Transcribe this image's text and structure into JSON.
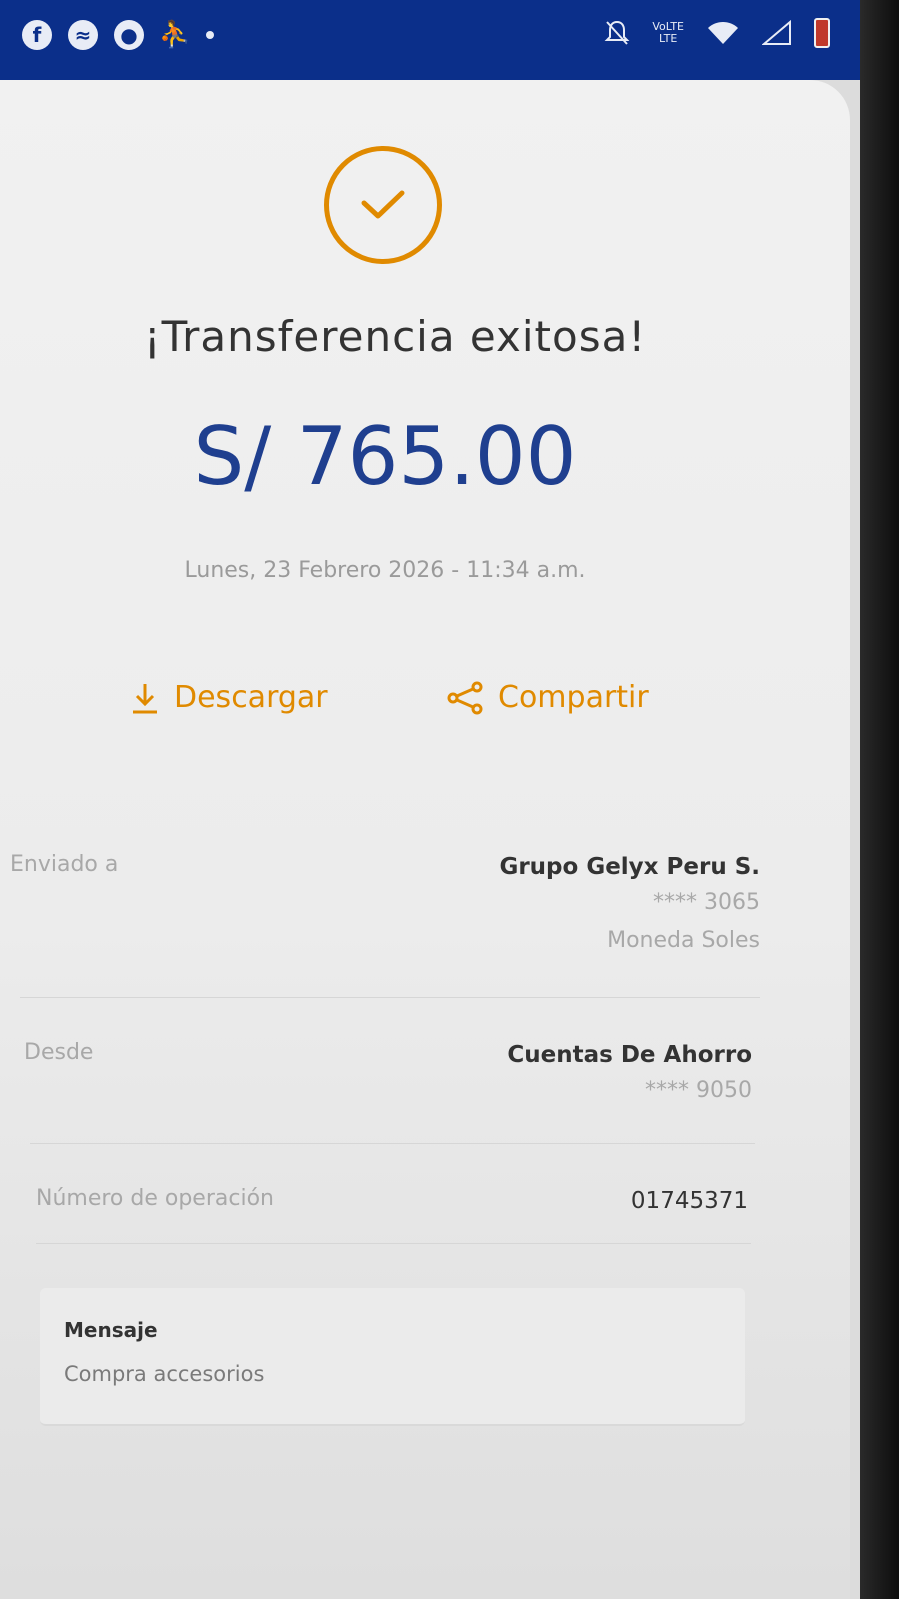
{
  "colors": {
    "status_bar": "#0b2f8a",
    "accent": "#e08a00",
    "amount": "#1f3f8f",
    "text_primary": "#333333",
    "text_muted": "#a8a8a8"
  },
  "status_bar": {
    "left_icons": [
      "facebook-icon",
      "messenger-icon",
      "chat-icon",
      "accessibility-icon"
    ],
    "right_icons": [
      "mute-icon",
      "volte-icon",
      "wifi-icon",
      "signal-icon",
      "battery-icon"
    ],
    "network_label_top": "VoLTE",
    "network_label_bottom": "LTE"
  },
  "receipt": {
    "status_icon": "check-circle-icon",
    "title": "¡Transferencia exitosa!",
    "amount": "S/ 765.00",
    "datetime": "Lunes, 23 Febrero 2026 - 11:34 a.m."
  },
  "actions": {
    "download": {
      "label": "Descargar",
      "icon": "download-icon"
    },
    "share": {
      "label": "Compartir",
      "icon": "share-icon"
    }
  },
  "details": {
    "sent_to": {
      "label": "Enviado a",
      "name": "Grupo Gelyx Peru S.",
      "account": "**** 3065",
      "currency": "Moneda Soles"
    },
    "from": {
      "label": "Desde",
      "name": "Cuentas De Ahorro",
      "account": "**** 9050"
    },
    "operation": {
      "label": "Número de operación",
      "value": "01745371"
    }
  },
  "message": {
    "label": "Mensaje",
    "text": "Compra accesorios"
  }
}
